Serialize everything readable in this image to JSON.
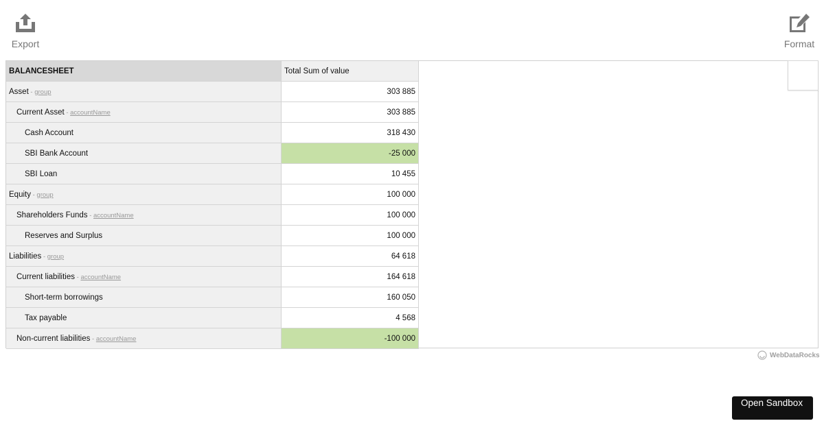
{
  "toolbar": {
    "export_label": "Export",
    "format_label": "Format"
  },
  "pivot": {
    "header": {
      "rows_title": "BALANCESHEET",
      "measure_title": "Total Sum of value"
    },
    "rows": [
      {
        "label": "Asset",
        "sub": "group",
        "value": "303 885"
      },
      {
        "label": "Current Asset",
        "sub": "accountName",
        "value": "303 885"
      },
      {
        "label": "Cash Account",
        "sub": "",
        "value": "318 430"
      },
      {
        "label": "SBI Bank Account",
        "sub": "",
        "value": "-25 000"
      },
      {
        "label": "SBI Loan",
        "sub": "",
        "value": "10 455"
      },
      {
        "label": "Equity",
        "sub": "group",
        "value": "100 000"
      },
      {
        "label": "Shareholders Funds",
        "sub": "accountName",
        "value": "100 000"
      },
      {
        "label": "Reserves and Surplus",
        "sub": "",
        "value": "100 000"
      },
      {
        "label": "Liabilities",
        "sub": "group",
        "value": "64 618"
      },
      {
        "label": "Current liabilities",
        "sub": "accountName",
        "value": "164 618"
      },
      {
        "label": "Short-term borrowings",
        "sub": "",
        "value": "160 050"
      },
      {
        "label": "Tax payable",
        "sub": "",
        "value": "4 568"
      },
      {
        "label": "Non-current liabilities",
        "sub": "accountName",
        "value": "-100 000"
      }
    ],
    "sub_prefix": "- ",
    "highlight_color": "#c6e0a6"
  },
  "brand": {
    "name": "WebDataRocks"
  },
  "sandbox": {
    "label": "Open Sandbox"
  }
}
